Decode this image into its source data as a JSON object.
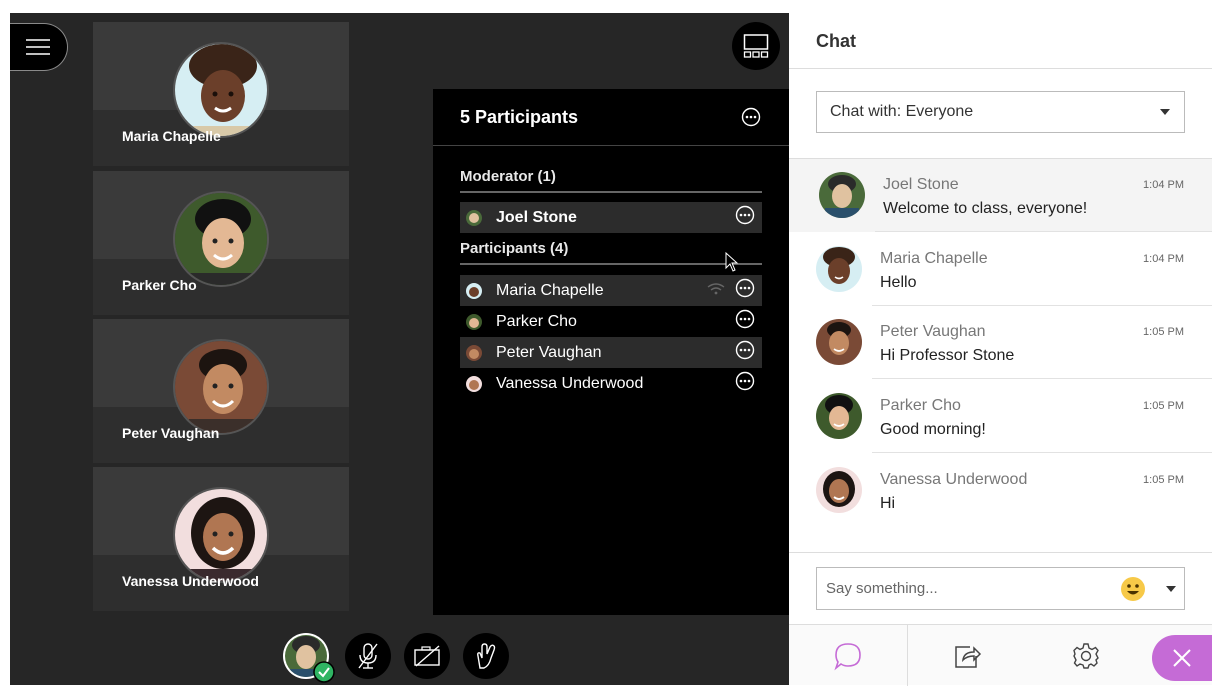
{
  "stage": {
    "tiles": [
      {
        "name": "Maria Chapelle",
        "skin": "#6b3f2a",
        "bg": "#d6eef3"
      },
      {
        "name": "Parker Cho",
        "skin": "#e3b894",
        "bg": "#3e5a2c"
      },
      {
        "name": "Peter Vaughan",
        "skin": "#c28a62",
        "bg": "#7a4a36"
      },
      {
        "name": "Vanessa Underwood",
        "skin": "#b07652",
        "bg": "#f2dede"
      }
    ]
  },
  "participants": {
    "title": "5 Participants",
    "moderator_header": "Moderator (1)",
    "participants_header": "Participants (4)",
    "moderators": [
      {
        "name": "Joel Stone"
      }
    ],
    "list": [
      {
        "name": "Maria Chapelle",
        "highlight": true,
        "wifi": true
      },
      {
        "name": "Parker Cho",
        "highlight": false,
        "wifi": false
      },
      {
        "name": "Peter Vaughan",
        "highlight": true,
        "wifi": false
      },
      {
        "name": "Vanessa Underwood",
        "highlight": false,
        "wifi": false
      }
    ]
  },
  "chat": {
    "title": "Chat",
    "chat_with": "Chat with: Everyone",
    "input_placeholder": "Say something...",
    "messages": [
      {
        "author": "Joel Stone",
        "time": "1:04 PM",
        "text": "Welcome to class, everyone!"
      },
      {
        "author": "Maria Chapelle",
        "time": "1:04 PM",
        "text": "Hello"
      },
      {
        "author": "Peter Vaughan",
        "time": "1:05 PM",
        "text": "Hi Professor Stone"
      },
      {
        "author": "Parker Cho",
        "time": "1:05 PM",
        "text": "Good morning!"
      },
      {
        "author": "Vanessa Underwood",
        "time": "1:05 PM",
        "text": "Hi"
      }
    ]
  },
  "colors": {
    "accent": "#c56bd6",
    "stage_bg": "#262626",
    "panel_bg": "#000000",
    "status_green": "#2fb463"
  },
  "icons": {
    "menu": "hamburger-menu-icon",
    "layout": "layout-grid-icon",
    "more": "more-options-icon",
    "mic": "mic-off-icon",
    "camera": "camera-off-icon",
    "hand": "raise-hand-icon",
    "chat": "chat-bubble-icon",
    "share": "share-content-icon",
    "settings": "gear-icon",
    "close": "close-icon"
  }
}
